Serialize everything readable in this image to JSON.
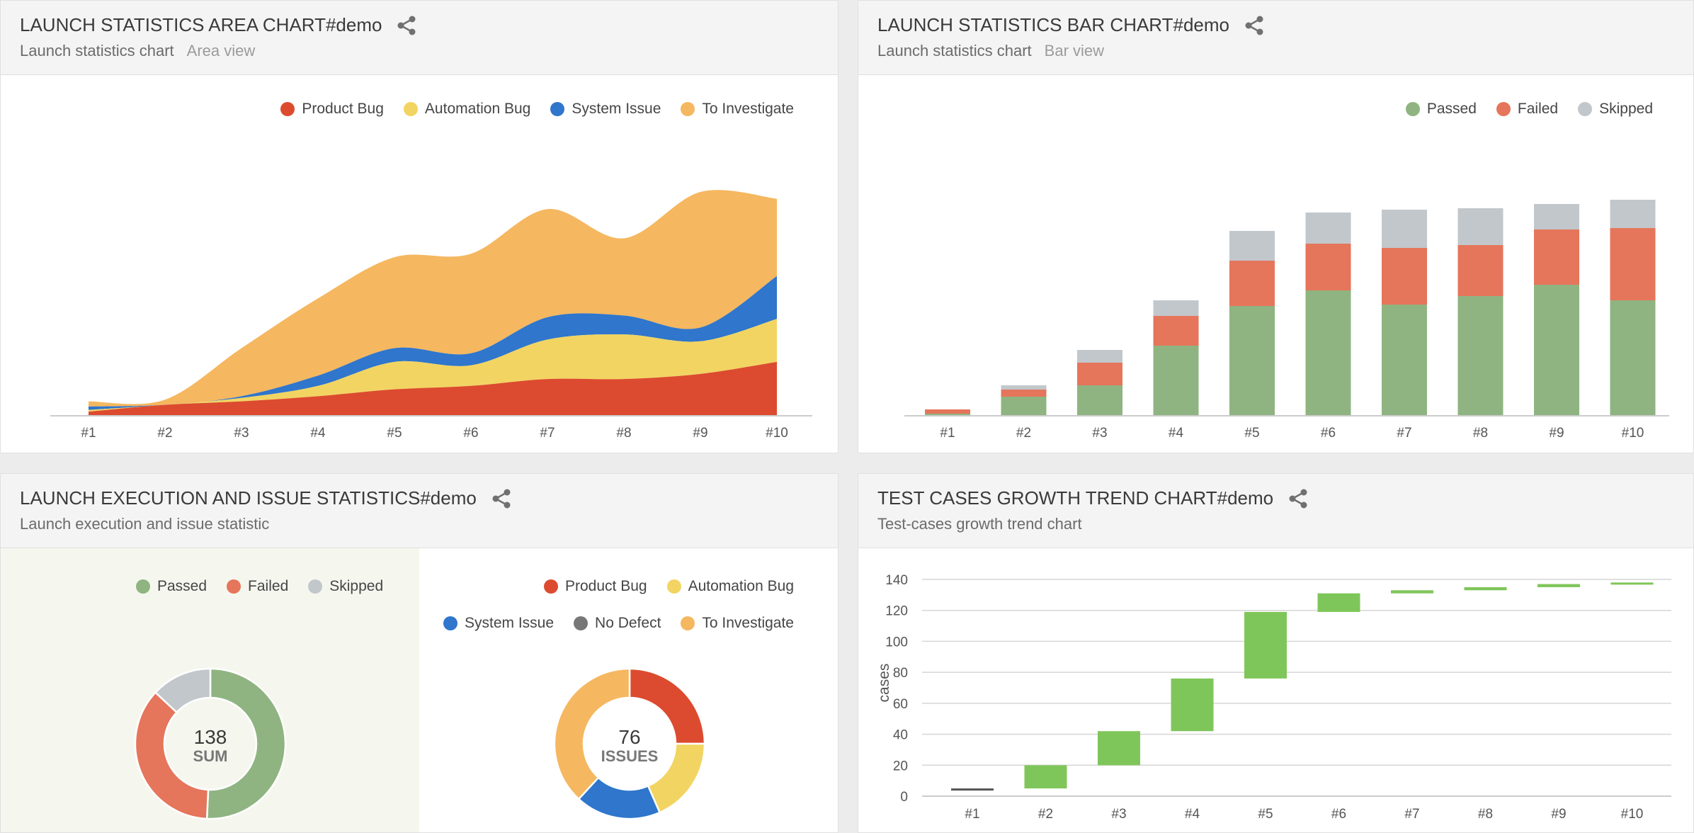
{
  "widgets": {
    "area": {
      "title": "LAUNCH STATISTICS AREA CHART#demo",
      "subtitle": "Launch statistics chart",
      "view": "Area view",
      "legend": [
        {
          "label": "Product Bug",
          "color": "#dc4b2f"
        },
        {
          "label": "Automation Bug",
          "color": "#f2d462"
        },
        {
          "label": "System Issue",
          "color": "#2f76cc"
        },
        {
          "label": "To Investigate",
          "color": "#f5b75f"
        }
      ]
    },
    "bar": {
      "title": "LAUNCH STATISTICS BAR CHART#demo",
      "subtitle": "Launch statistics chart",
      "view": "Bar view",
      "legend": [
        {
          "label": "Passed",
          "color": "#8fb481"
        },
        {
          "label": "Failed",
          "color": "#e5755b"
        },
        {
          "label": "Skipped",
          "color": "#c2c7cb"
        }
      ]
    },
    "execution": {
      "title": "LAUNCH EXECUTION AND ISSUE STATISTICS#demo",
      "subtitle": "Launch execution and issue statistic",
      "legend_left": [
        {
          "label": "Passed",
          "color": "#8fb481"
        },
        {
          "label": "Failed",
          "color": "#e5755b"
        },
        {
          "label": "Skipped",
          "color": "#c2c7cb"
        }
      ],
      "legend_right_row1": [
        {
          "label": "Product Bug",
          "color": "#dc4b2f"
        },
        {
          "label": "Automation Bug",
          "color": "#f2d462"
        }
      ],
      "legend_right_row2": [
        {
          "label": "System Issue",
          "color": "#2f76cc"
        },
        {
          "label": "No Defect",
          "color": "#777777"
        },
        {
          "label": "To Investigate",
          "color": "#f5b75f"
        }
      ],
      "sum_value": "138",
      "sum_label": "SUM",
      "issues_value": "76",
      "issues_label": "ISSUES"
    },
    "trend": {
      "title": "TEST CASES GROWTH TREND CHART#demo",
      "subtitle": "Test-cases growth trend chart"
    }
  },
  "chart_data": [
    {
      "type": "area",
      "stacked": true,
      "categories": [
        "#1",
        "#2",
        "#3",
        "#4",
        "#5",
        "#6",
        "#7",
        "#8",
        "#9",
        "#10"
      ],
      "series": [
        {
          "name": "Product Bug",
          "color": "#dc4b2f",
          "values": [
            2,
            6,
            8,
            11,
            15,
            17,
            21,
            21,
            24,
            31
          ]
        },
        {
          "name": "Automation Bug",
          "color": "#f2d462",
          "values": [
            1,
            0,
            2,
            6,
            16,
            12,
            23,
            26,
            19,
            25
          ]
        },
        {
          "name": "System Issue",
          "color": "#2f76cc",
          "values": [
            2,
            0,
            1,
            6,
            8,
            7,
            13,
            11,
            8,
            25
          ]
        },
        {
          "name": "To Investigate",
          "color": "#f5b75f",
          "values": [
            3,
            3,
            28,
            45,
            53,
            58,
            63,
            45,
            79,
            45
          ]
        }
      ],
      "ylim": [
        0,
        130
      ]
    },
    {
      "type": "bar",
      "stacked": true,
      "categories": [
        "#1",
        "#2",
        "#3",
        "#4",
        "#5",
        "#6",
        "#7",
        "#8",
        "#9",
        "#10"
      ],
      "series": [
        {
          "name": "Passed",
          "color": "#8fb481",
          "values": [
            1,
            13,
            21,
            49,
            77,
            88,
            78,
            84,
            92,
            81
          ]
        },
        {
          "name": "Failed",
          "color": "#e5755b",
          "values": [
            3,
            5,
            16,
            21,
            32,
            33,
            40,
            36,
            39,
            51
          ]
        },
        {
          "name": "Skipped",
          "color": "#c2c7cb",
          "values": [
            0,
            3,
            9,
            11,
            21,
            22,
            27,
            26,
            18,
            20
          ]
        }
      ],
      "ylim": [
        0,
        160
      ]
    },
    {
      "type": "pie",
      "center_label": "138 SUM",
      "slices": [
        {
          "name": "Passed",
          "value": 70,
          "color": "#8fb481"
        },
        {
          "name": "Failed",
          "value": 50,
          "color": "#e5755b"
        },
        {
          "name": "Skipped",
          "value": 18,
          "color": "#c2c7cb"
        }
      ]
    },
    {
      "type": "pie",
      "center_label": "76 ISSUES",
      "slices": [
        {
          "name": "Product Bug",
          "value": 19,
          "color": "#dc4b2f"
        },
        {
          "name": "Automation Bug",
          "value": 14,
          "color": "#f2d462"
        },
        {
          "name": "System Issue",
          "value": 14,
          "color": "#2f76cc"
        },
        {
          "name": "No Defect",
          "value": 0,
          "color": "#777777"
        },
        {
          "name": "To Investigate",
          "value": 29,
          "color": "#f5b75f"
        }
      ]
    },
    {
      "type": "bar",
      "subtype": "waterfall",
      "categories": [
        "#1",
        "#2",
        "#3",
        "#4",
        "#5",
        "#6",
        "#7",
        "#8",
        "#9",
        "#10"
      ],
      "start": [
        4,
        5,
        20,
        42,
        76,
        119,
        131,
        133,
        135,
        137
      ],
      "end": [
        5,
        20,
        42,
        76,
        119,
        131,
        133,
        135,
        137,
        138
      ],
      "ylabel": "cases",
      "yticks": [
        0,
        20,
        40,
        60,
        80,
        100,
        120,
        140
      ],
      "ylim": [
        0,
        145
      ],
      "color": "#7fc65a"
    }
  ]
}
